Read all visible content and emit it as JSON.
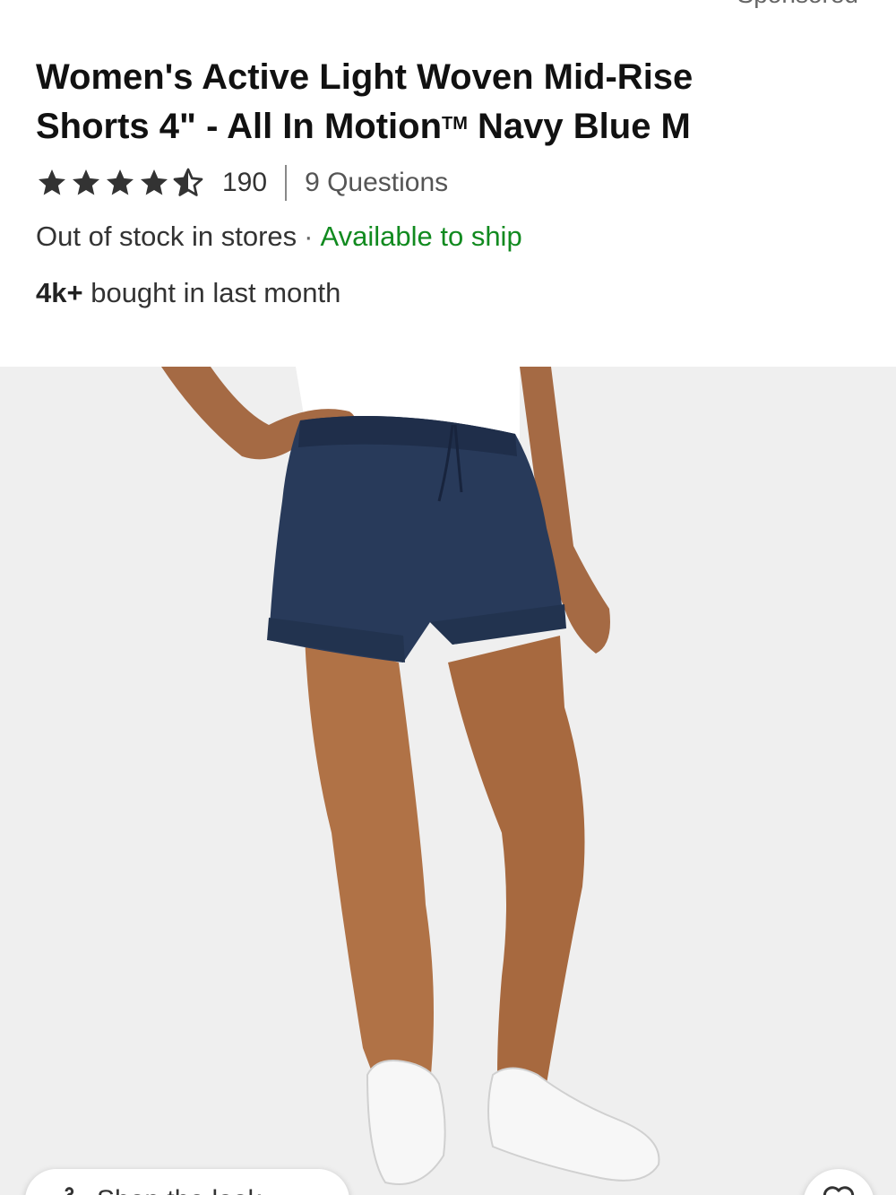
{
  "header": {
    "sponsored_label": "Sponsored"
  },
  "product": {
    "title_line1": "Women's Active Light Woven Mid-Rise",
    "title_line2_prefix": "Shorts 4\" - All In Motion",
    "trademark": "TM",
    "title_line2_suffix": " Navy Blue M",
    "rating": 4.5,
    "rating_max": 5,
    "review_count": "190",
    "questions_label": "9 Questions",
    "stock_status": "Out of stock in stores",
    "separator": "·",
    "ship_status": "Available to ship",
    "bought_count": "4k+",
    "bought_label": " bought in last month"
  },
  "actions": {
    "chip_label": "Shop the look",
    "favorite_icon": "heart-icon",
    "chip_icon": "hanger-icon"
  },
  "colors": {
    "available_green": "#118a1f",
    "shorts_navy": "#283a5a",
    "hero_bg": "#efefef"
  }
}
